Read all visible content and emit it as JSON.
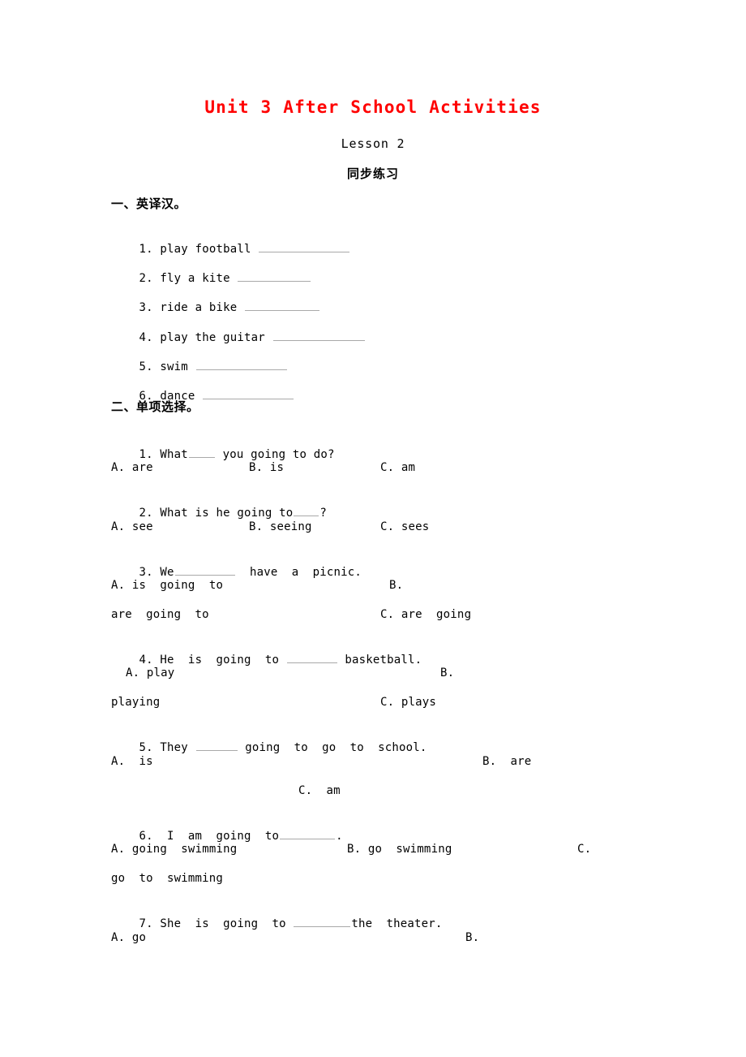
{
  "document": {
    "title": "Unit 3 After School Activities",
    "lesson": "Lesson 2",
    "exercise_label": "同步练习"
  },
  "colors": {
    "title_red": "#ff0000",
    "text_black": "#000000",
    "blank_rule": "#a9a9a9"
  },
  "section_one": {
    "heading": "一、英译汉。",
    "items": [
      {
        "number": "1.",
        "text": "play football"
      },
      {
        "number": "2.",
        "text": "fly a kite"
      },
      {
        "number": "3.",
        "text": "ride a bike"
      },
      {
        "number": "4.",
        "text": "play the guitar"
      },
      {
        "number": "5.",
        "text": "swim"
      },
      {
        "number": "6.",
        "text": "dance"
      }
    ]
  },
  "section_two": {
    "heading": "二、单项选择。",
    "questions": [
      {
        "number": "1.",
        "stem_before": "What",
        "stem_after": " you going to do?",
        "options": [
          {
            "label": "A.",
            "text": "are"
          },
          {
            "label": "B.",
            "text": "is"
          },
          {
            "label": "C.",
            "text": "am"
          }
        ]
      },
      {
        "number": "2.",
        "stem_before": "What is he going to",
        "stem_after": "?",
        "options": [
          {
            "label": "A.",
            "text": "see"
          },
          {
            "label": "B.",
            "text": "seeing"
          },
          {
            "label": "C.",
            "text": "sees"
          }
        ]
      },
      {
        "number": "3.",
        "stem_before": "We",
        "stem_after": "  have  a  picnic.",
        "options": [
          {
            "label": "A.",
            "text": "is  going  to"
          },
          {
            "label": "B.",
            "text": "are  going  to"
          },
          {
            "label": "C.",
            "text": "are  going"
          }
        ]
      },
      {
        "number": "4.",
        "stem_before": "He  is  going  to ",
        "stem_after": " basketball.",
        "options": [
          {
            "label": "A.",
            "text": "play"
          },
          {
            "label": "B.",
            "text": "playing"
          },
          {
            "label": "C.",
            "text": "plays"
          }
        ]
      },
      {
        "number": "5.",
        "stem_before": "They ",
        "stem_after": " going  to  go  to  school.",
        "options": [
          {
            "label": "A.",
            "text": "is"
          },
          {
            "label": "B.",
            "text": "are"
          },
          {
            "label": "C.",
            "text": "am"
          }
        ]
      },
      {
        "number": "6.",
        "stem_before": "I  am  going  to",
        "stem_after": ".",
        "options": [
          {
            "label": "A.",
            "text": "going  swimming"
          },
          {
            "label": "B.",
            "text": "go  swimming"
          },
          {
            "label": "C.",
            "text": "go  to  swimming"
          }
        ]
      },
      {
        "number": "7.",
        "stem_before": "She  is  going  to ",
        "stem_after": "the  theater.",
        "options": [
          {
            "label": "A.",
            "text": "go"
          },
          {
            "label": "B.",
            "text": ""
          }
        ]
      }
    ]
  }
}
